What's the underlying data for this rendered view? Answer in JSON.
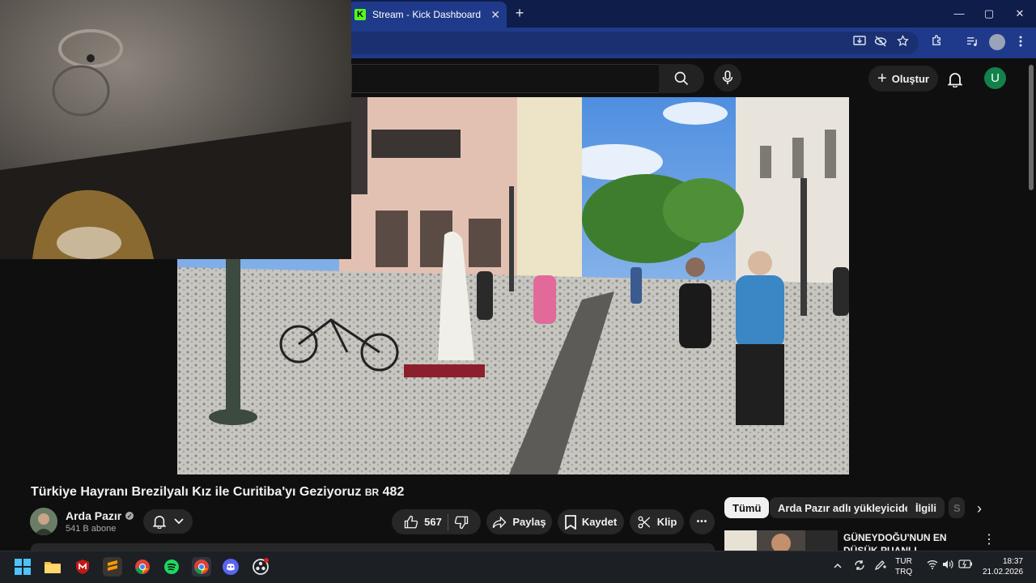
{
  "browser": {
    "tab_title": "Stream - Kick Dashboard",
    "tab_icon_letter": "K",
    "new_tab_symbol": "+",
    "tab_close_symbol": "✕",
    "window_minimize": "—",
    "window_maximize": "▢",
    "window_close": "✕"
  },
  "youtube": {
    "create_label": "Oluştur",
    "create_symbol": "+",
    "avatar_letter": "U"
  },
  "video": {
    "title": "Türkiye Hayranı Brezilyalı Kız ile Curitiba'yı Geziyoruz",
    "title_flag": "BR",
    "title_number": "482",
    "channel_name": "Arda Pazır",
    "subscribers": "541 B abone",
    "likes": "567",
    "share_label": "Paylaş",
    "save_label": "Kaydet",
    "clip_label": "Klip",
    "more_symbol": "•••"
  },
  "chips": {
    "all": "Tümü",
    "uploader": "Arda Pazır adlı yükleyiciden",
    "related": "İlgili",
    "partial": "S",
    "next_symbol": "›"
  },
  "recommendation": {
    "title": "GÜNEYDOĞU'NUN EN DÜŞÜK PUANLI RESTORANTLARI",
    "menu_symbol": "⋮"
  },
  "taskbar": {
    "lang_line1": "TUR",
    "lang_line2": "TRQ",
    "time": "18:37",
    "date": "21.02.2026"
  },
  "colors": {
    "kick_green": "#53fc18",
    "browser_frame": "#1f3a8a",
    "yt_background": "#0f0f0f",
    "avatar_green": "#12824a"
  }
}
